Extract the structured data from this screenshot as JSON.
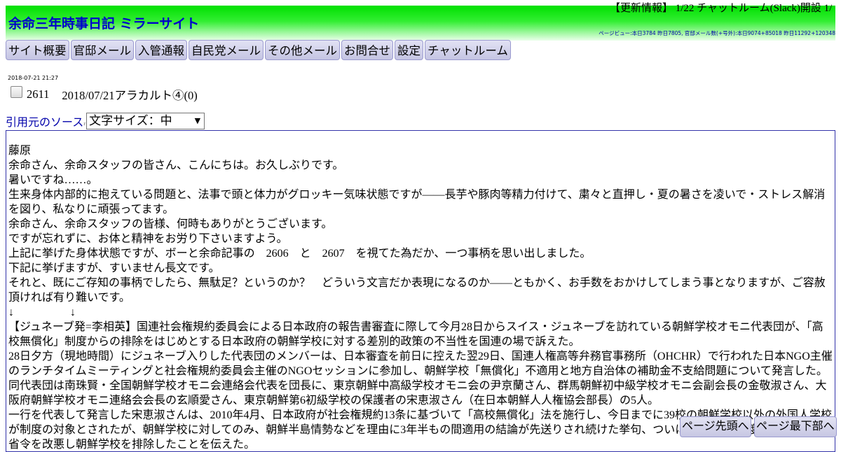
{
  "header": {
    "title": "余命三年時事日記 ミラーサイト",
    "update_info": "【更新情報】 1/22 チャットルーム(Slack)開設 1/",
    "pageview": "ページビュー:本日3784 昨日7805, 官邸メール数(+号外):本日9074+85018 昨日11292+120348"
  },
  "nav": [
    "サイト概要",
    "官邸メール",
    "入管通報",
    "自民党メール",
    "その他メール",
    "お問合せ",
    "設定",
    "チャットルーム"
  ],
  "post": {
    "timestamp": "2018-07-21 21:27",
    "number": "2611",
    "title": "2018/07/21アラカルト④(0)"
  },
  "source": {
    "link_label": "引用元のソース",
    "ext_mark": "r"
  },
  "font_size_select": {
    "value": "文字サイズ：中"
  },
  "article": {
    "lines": [
      "藤原",
      "余命さん、余命スタッフの皆さん、こんにちは。お久しぶりです。",
      "暑いですね……。",
      "生来身体内部的に抱えている問題と、法事で頭と体力がグロッキー気味状態ですが――長芋や豚肉等精力付けて、粛々と直押し・夏の暑さを凌いで・ストレス解消を図り、私なりに頑張ってます。",
      "余命さん、余命スタッフの皆様、何時もありがとうございます。",
      "ですが忘れずに、お体と精神をお労り下さいますよう。",
      "上記に挙げた身体状態ですが、ボーと余命記事の　2606　と　2607　を視てた為だか、一つ事柄を思い出しました。",
      "下記に挙げますが、すいません長文です。",
      "それと、既にご存知の事柄でしたら、無駄足？というのか？　どういう文言だか表現になるのか――ともかく、お手数をおかけしてしまう事となりますが、ご容赦頂ければ有り難いです。",
      "↓　　　　　↓",
      "【ジュネーブ発=李相英】国連社会権規約委員会による日本政府の報告書審査に際して今月28日からスイス・ジュネーブを訪れている朝鮮学校オモニ代表団が、「高校無償化」制度からの排除をはじめとする日本政府の朝鮮学校に対する差別的政策の不当性を国連の場で訴えた。",
      "28日夕方（現地時間）にジュネーブ入りした代表団のメンバーは、日本審査を前日に控えた翌29日、国連人権高等弁務官事務所（OHCHR）で行われた日本NGO主催のランチタイムミーティングと社会権規約委員会主催のNGOセッションに参加し、朝鮮学校「無償化」不適用と地方自治体の補助金不支給問題について発言した。",
      "同代表団は南珠賢・全国朝鮮学校オモニ会連絡会代表を団長に、東京朝鮮中高級学校オモニ会の尹京蘭さん、群馬朝鮮初中級学校オモニ会副会長の金敬淑さん、大阪府朝鮮学校オモニ連絡会会長の玄順愛さん、東京朝鮮第6初級学校の保護者の宋恵淑さん（在日本朝鮮人人権協会部長）の5人。",
      "一行を代表して発言した宋恵淑さんは、2010年4月、日本政府が社会権規約13条に基づいて「高校無償化」法を施行し、今日までに39校の朝鮮学校以外の外国人学校が制度の対象とされたが、朝鮮学校に対してのみ、朝鮮半島情勢などを理由に3年半もの間適用の結論が先送りされ続けた挙句、ついに今年2月、制度適用に関する省令を改悪し朝鮮学校を排除したことを伝えた。"
    ]
  },
  "buttons": {
    "page_top": "ページ先頭へ",
    "page_bottom": "ページ最下部へ"
  }
}
